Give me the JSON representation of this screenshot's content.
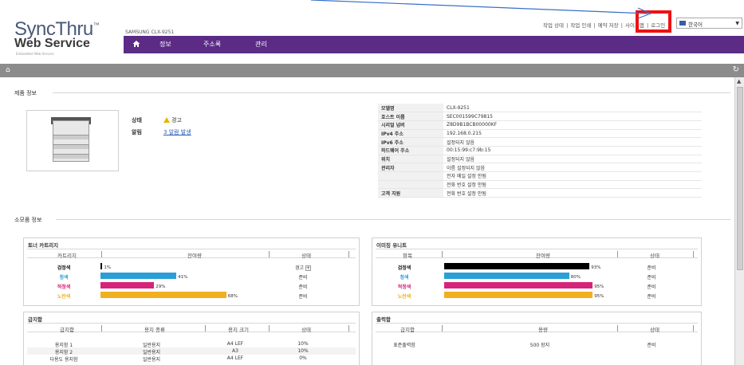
{
  "header": {
    "logo_line1": "SyncThru",
    "logo_tm": "™",
    "logo_line2": "Web Service",
    "logo_tagline": "Embedded Web Service",
    "model": "SAMSUNG CLX-9251",
    "nav": [
      "정보",
      "주소록",
      "관리"
    ],
    "toplinks": [
      "작업 상태",
      "작업 인쇄",
      "예약 저장",
      "사이트맵",
      "로그인"
    ],
    "language": "한국어"
  },
  "product_section": {
    "title": "제품 정보",
    "status_label": "상태",
    "status_value": "경고",
    "alert_label": "알림",
    "alert_value": "3 알람 발생",
    "info": [
      {
        "k": "모델명",
        "v": "CLX-9251"
      },
      {
        "k": "호스트 이름",
        "v": "SEC001599C79815"
      },
      {
        "k": "시리얼 넘버",
        "v": "Z8D9B1BCB00000KF"
      },
      {
        "k": "IPv4 주소",
        "v": "192.168.0.215"
      },
      {
        "k": "IPv6 주소",
        "v": "설정되지 않음"
      },
      {
        "k": "하드웨어 주소",
        "v": "00:15:99:c7:9b:15"
      },
      {
        "k": "위치",
        "v": "설정되지 않음"
      },
      {
        "k": "관리자",
        "v": "이름 설정되지 않음"
      },
      {
        "k": "",
        "v": "전자 메일 설정 안됨"
      },
      {
        "k": "",
        "v": "전화 번호 설정 안됨"
      },
      {
        "k": "고객 지원",
        "v": "전화 번호 설정 안됨"
      }
    ]
  },
  "supplies_section": {
    "title": "소모품 정보",
    "toner": {
      "title": "토너 카트리지",
      "headers": [
        "카트리지",
        "잔여량",
        "상태"
      ],
      "rows": [
        {
          "name": "검정색",
          "pct": 1,
          "pct_label": "1%",
          "status": "경고",
          "color": "#111111",
          "label_color": "#111111"
        },
        {
          "name": "청색",
          "pct": 41,
          "pct_label": "41%",
          "status": "준비",
          "color": "#2a9fd6",
          "label_color": "#2a9fd6"
        },
        {
          "name": "적청색",
          "pct": 29,
          "pct_label": "29%",
          "status": "준비",
          "color": "#d6247a",
          "label_color": "#d6247a"
        },
        {
          "name": "노란색",
          "pct": 68,
          "pct_label": "68%",
          "status": "준비",
          "color": "#f0b020",
          "label_color": "#f0b020"
        }
      ]
    },
    "imaging": {
      "title": "이미징 유니트",
      "headers": [
        "항목",
        "잔여량",
        "상태"
      ],
      "rows": [
        {
          "name": "검정색",
          "pct": 93,
          "pct_label": "93%",
          "status": "준비",
          "color": "#000000",
          "label_color": "#111111"
        },
        {
          "name": "청색",
          "pct": 80,
          "pct_label": "80%",
          "status": "준비",
          "color": "#2a9fd6",
          "label_color": "#2a9fd6"
        },
        {
          "name": "적청색",
          "pct": 95,
          "pct_label": "95%",
          "status": "준비",
          "color": "#d6247a",
          "label_color": "#d6247a"
        },
        {
          "name": "노란색",
          "pct": 95,
          "pct_label": "95%",
          "status": "준비",
          "color": "#f0b020",
          "label_color": "#f0b020"
        }
      ]
    },
    "input_tray": {
      "title": "급지함",
      "headers": [
        "급지함",
        "용지 종류",
        "용지 크기",
        "상태"
      ],
      "rows": [
        [
          "용지함 1",
          "일반용지",
          "A4 LEF",
          "10%"
        ],
        [
          "용지함 2",
          "일반용지",
          "A3",
          "10%"
        ],
        [
          "다용도 용지함",
          "일반용지",
          "A4 LEF",
          "0%"
        ]
      ]
    },
    "output_tray": {
      "title": "출력함",
      "headers": [
        "급지함",
        "용량",
        "상태"
      ],
      "rows": [
        [
          "표준출력함",
          "500 장지",
          "준비"
        ]
      ]
    }
  },
  "colors": {
    "nav_bg": "#5b2b86",
    "highlight": "#ee1111",
    "arrow": "#3a6fc9"
  }
}
